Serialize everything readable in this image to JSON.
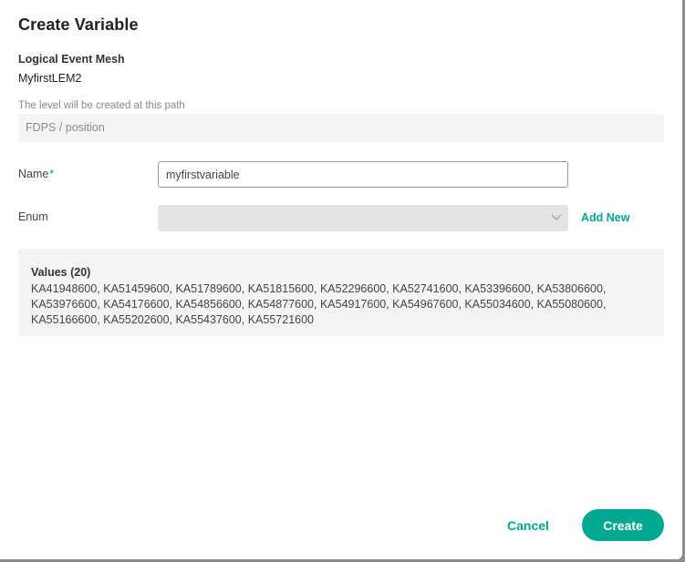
{
  "dialog": {
    "title": "Create Variable"
  },
  "lem": {
    "label": "Logical Event Mesh",
    "value": "MyfirstLEM2"
  },
  "path": {
    "label": "The level will be created at this path",
    "value": "FDPS / position"
  },
  "name_field": {
    "label": "Name",
    "required_mark": "*",
    "value": "myfirstvariable"
  },
  "enum_field": {
    "label": "Enum",
    "selected": "",
    "add_new_label": "Add New"
  },
  "values": {
    "title": "Values (20)",
    "list": "KA41948600, KA51459600, KA51789600, KA51815600, KA52296600, KA52741600, KA53396600, KA53806600, KA53976600, KA54176600, KA54856600, KA54877600, KA54917600, KA54967600, KA55034600, KA55080600, KA55166600, KA55202600, KA55437600, KA55721600"
  },
  "actions": {
    "cancel_label": "Cancel",
    "create_label": "Create"
  },
  "colors": {
    "accent": "#00a88f",
    "panel_bg": "#f4f4f4",
    "select_bg": "#e4e4e4"
  },
  "icons": {
    "enum_dropdown": "chevron-down-icon"
  }
}
